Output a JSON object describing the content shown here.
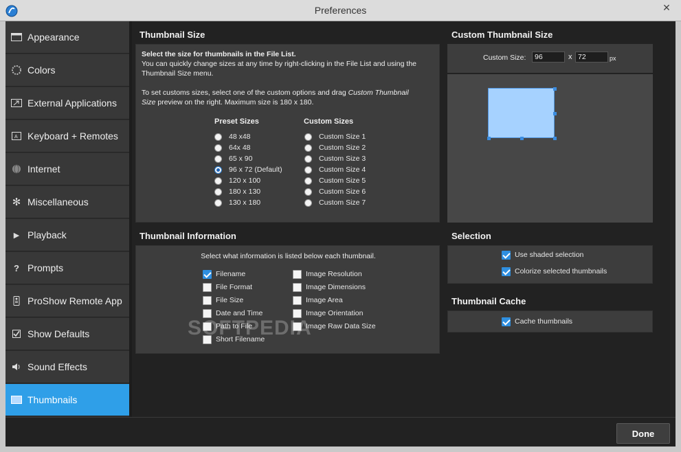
{
  "window": {
    "title": "Preferences",
    "close_glyph": "✕"
  },
  "sidebar": {
    "items": [
      {
        "label": "Appearance",
        "icon": "window-icon"
      },
      {
        "label": "Colors",
        "icon": "palette-icon"
      },
      {
        "label": "External Applications",
        "icon": "external-icon"
      },
      {
        "label": "Keyboard + Remotes",
        "icon": "keyboard-icon"
      },
      {
        "label": "Internet",
        "icon": "globe-icon"
      },
      {
        "label": "Miscellaneous",
        "icon": "gear-icon"
      },
      {
        "label": "Playback",
        "icon": "play-icon"
      },
      {
        "label": "Prompts",
        "icon": "question-icon"
      },
      {
        "label": "ProShow Remote App",
        "icon": "remote-icon"
      },
      {
        "label": "Show Defaults",
        "icon": "checkmark-icon"
      },
      {
        "label": "Sound Effects",
        "icon": "speaker-icon"
      },
      {
        "label": "Thumbnails",
        "icon": "thumbnail-icon",
        "active": true
      }
    ]
  },
  "thumbnail_size": {
    "title": "Thumbnail Size",
    "intro_bold": "Select the size for thumbnails in the File List.",
    "intro_1": "You can quickly change sizes at any time by right-clicking in the File List and using the",
    "intro_2": "Thumbnail Size menu.",
    "custom_1a": "To set customs sizes, select one of the custom options and drag ",
    "custom_1b": "Custom Thumbnail",
    "custom_2a": "Size",
    "custom_2b": " preview on the right. Maximum size is 180 x 180.",
    "preset_header": "Preset Sizes",
    "custom_header": "Custom Sizes",
    "presets": [
      "48 x48",
      "64x 48",
      "65 x 90",
      "96 x 72 (Default)",
      "120 x 100",
      "180 x 130",
      "130 x 180"
    ],
    "selected_preset": 3,
    "customs": [
      "Custom Size 1",
      "Custom Size 2",
      "Custom Size 3",
      "Custom Size 4",
      "Custom Size 5",
      "Custom Size 6",
      "Custom Size 7"
    ]
  },
  "custom_thumbnail": {
    "title": "Custom Thumbnail Size",
    "label": "Custom Size:",
    "width": "96",
    "x": "x",
    "height": "72",
    "unit": "px"
  },
  "thumbnail_info": {
    "title": "Thumbnail Information",
    "subtitle": "Select what information is listed below each thumbnail.",
    "left": [
      {
        "label": "Filename",
        "checked": true
      },
      {
        "label": "File Format",
        "checked": false
      },
      {
        "label": "File Size",
        "checked": false
      },
      {
        "label": "Date and Time",
        "checked": false
      },
      {
        "label": "Path to File",
        "checked": false
      },
      {
        "label": "Short Filename",
        "checked": false
      }
    ],
    "right": [
      {
        "label": "Image Resolution",
        "checked": false
      },
      {
        "label": "Image Dimensions",
        "checked": false
      },
      {
        "label": "Image Area",
        "checked": false
      },
      {
        "label": "Image Orientation",
        "checked": false
      },
      {
        "label": "Image Raw Data Size",
        "checked": false
      }
    ]
  },
  "selection": {
    "title": "Selection",
    "items": [
      {
        "label": "Use shaded selection",
        "checked": true
      },
      {
        "label": "Colorize selected thumbnails",
        "checked": true
      }
    ]
  },
  "cache": {
    "title": "Thumbnail Cache",
    "items": [
      {
        "label": "Cache thumbnails",
        "checked": true
      }
    ]
  },
  "footer": {
    "done_label": "Done"
  },
  "watermark": "SOFTPEDIA",
  "colors": {
    "accent": "#2f9fe8",
    "panel": "#3d3d3d",
    "background": "#222222"
  }
}
